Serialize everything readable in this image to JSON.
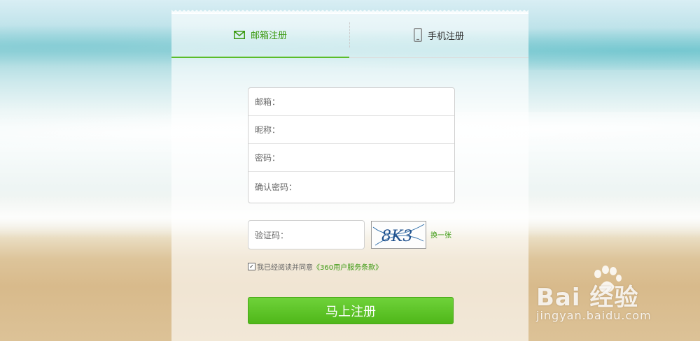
{
  "tabs": [
    {
      "label": "邮箱注册",
      "icon": "envelope-icon",
      "active": true
    },
    {
      "label": "手机注册",
      "icon": "mobile-phone-icon",
      "active": false
    }
  ],
  "form": {
    "email_label": "邮箱：",
    "nickname_label": "昵称：",
    "password_label": "密码：",
    "confirm_label": "确认密码：",
    "captcha_label": "验证码：",
    "captcha_text": "8K3",
    "refresh_label": "换一张",
    "agree_text": "我已经阅读并同意",
    "agree_link": "《360用户服务条款》",
    "agree_checked": true,
    "submit_label": "马上注册"
  },
  "watermark": {
    "brand": "Bai  经验",
    "url": "jingyan.baidu.com"
  },
  "colors": {
    "accent": "#3c9a12",
    "button": "#5bc224"
  }
}
